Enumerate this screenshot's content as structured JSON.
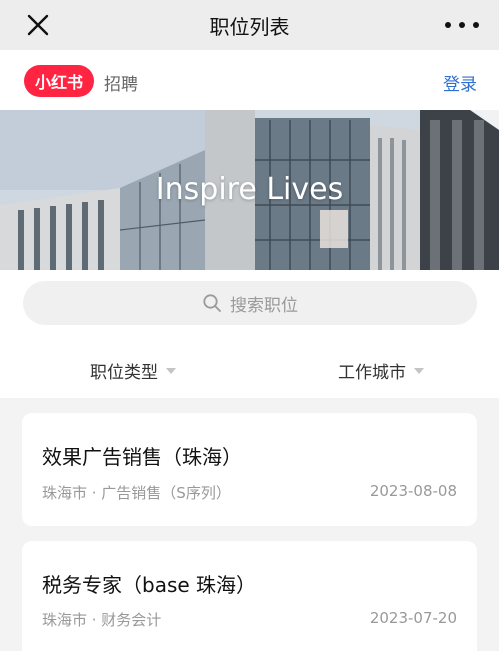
{
  "titlebar": {
    "title": "职位列表"
  },
  "brand": {
    "logo_text": "小红书",
    "subtitle": "招聘",
    "login_label": "登录"
  },
  "banner": {
    "slogan": "Inspire Lives"
  },
  "search": {
    "placeholder": "搜索职位"
  },
  "filters": [
    {
      "label": "职位类型"
    },
    {
      "label": "工作城市"
    }
  ],
  "jobs": [
    {
      "title": "效果广告销售（珠海）",
      "meta": "珠海市 · 广告销售（S序列）",
      "date": "2023-08-08"
    },
    {
      "title": "税务专家（base 珠海）",
      "meta": "珠海市 · 财务会计",
      "date": "2023-07-20"
    }
  ],
  "colors": {
    "brand_red": "#ff2442",
    "link_blue": "#2f6fd1"
  },
  "icons": [
    "close-icon",
    "more-icon",
    "search-icon",
    "caret-down-icon"
  ]
}
